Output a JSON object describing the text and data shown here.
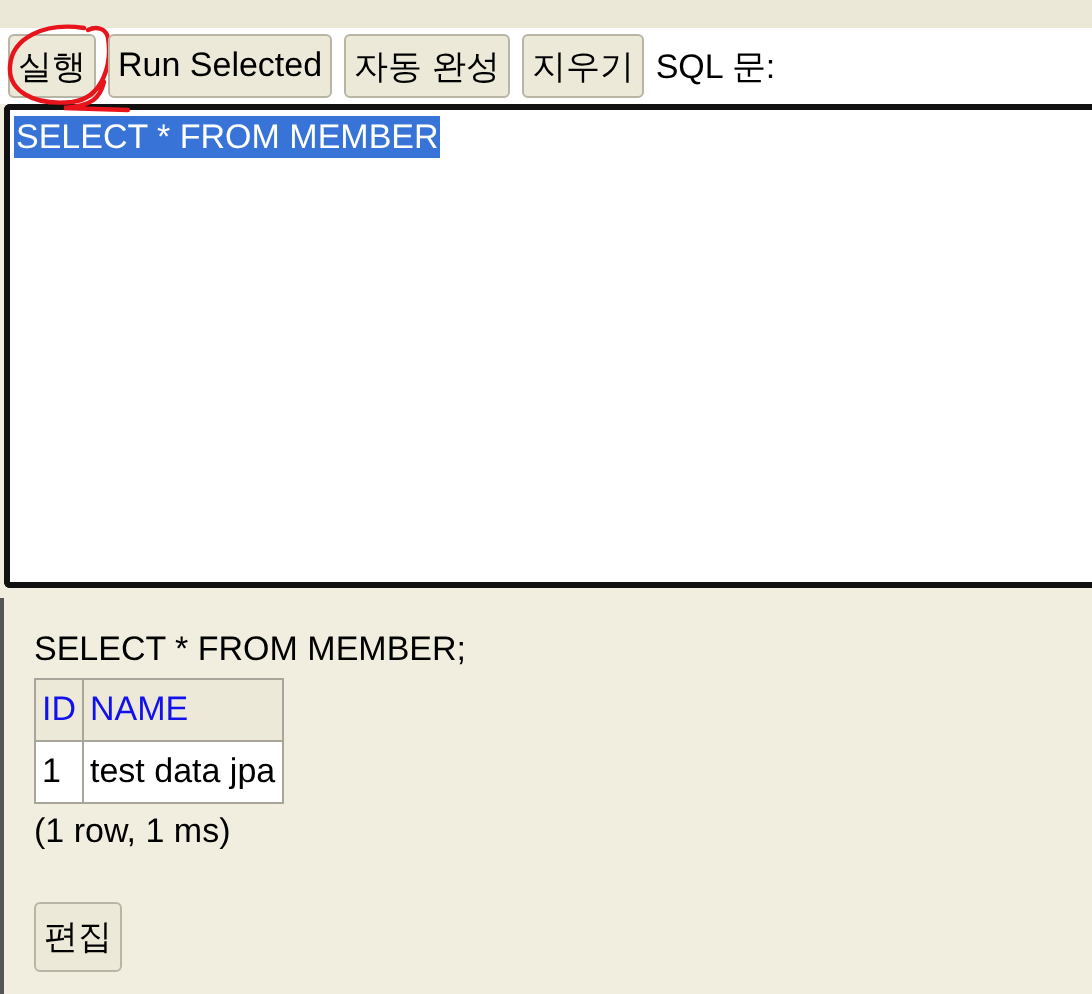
{
  "toolbar": {
    "buttons": [
      {
        "label": "실행",
        "circled": true
      },
      {
        "label": "Run Selected",
        "circled": false
      },
      {
        "label": "자동 완성",
        "circled": false
      },
      {
        "label": "지우기",
        "circled": false
      }
    ],
    "label": "SQL 문:"
  },
  "editor": {
    "text": "SELECT * FROM MEMBER",
    "selected": true
  },
  "result": {
    "query": "SELECT * FROM MEMBER;",
    "columns": [
      "ID",
      "NAME"
    ],
    "rows": [
      [
        "1",
        "test data jpa"
      ]
    ],
    "summary": "(1 row, 1 ms)",
    "edit_button": "편집"
  }
}
